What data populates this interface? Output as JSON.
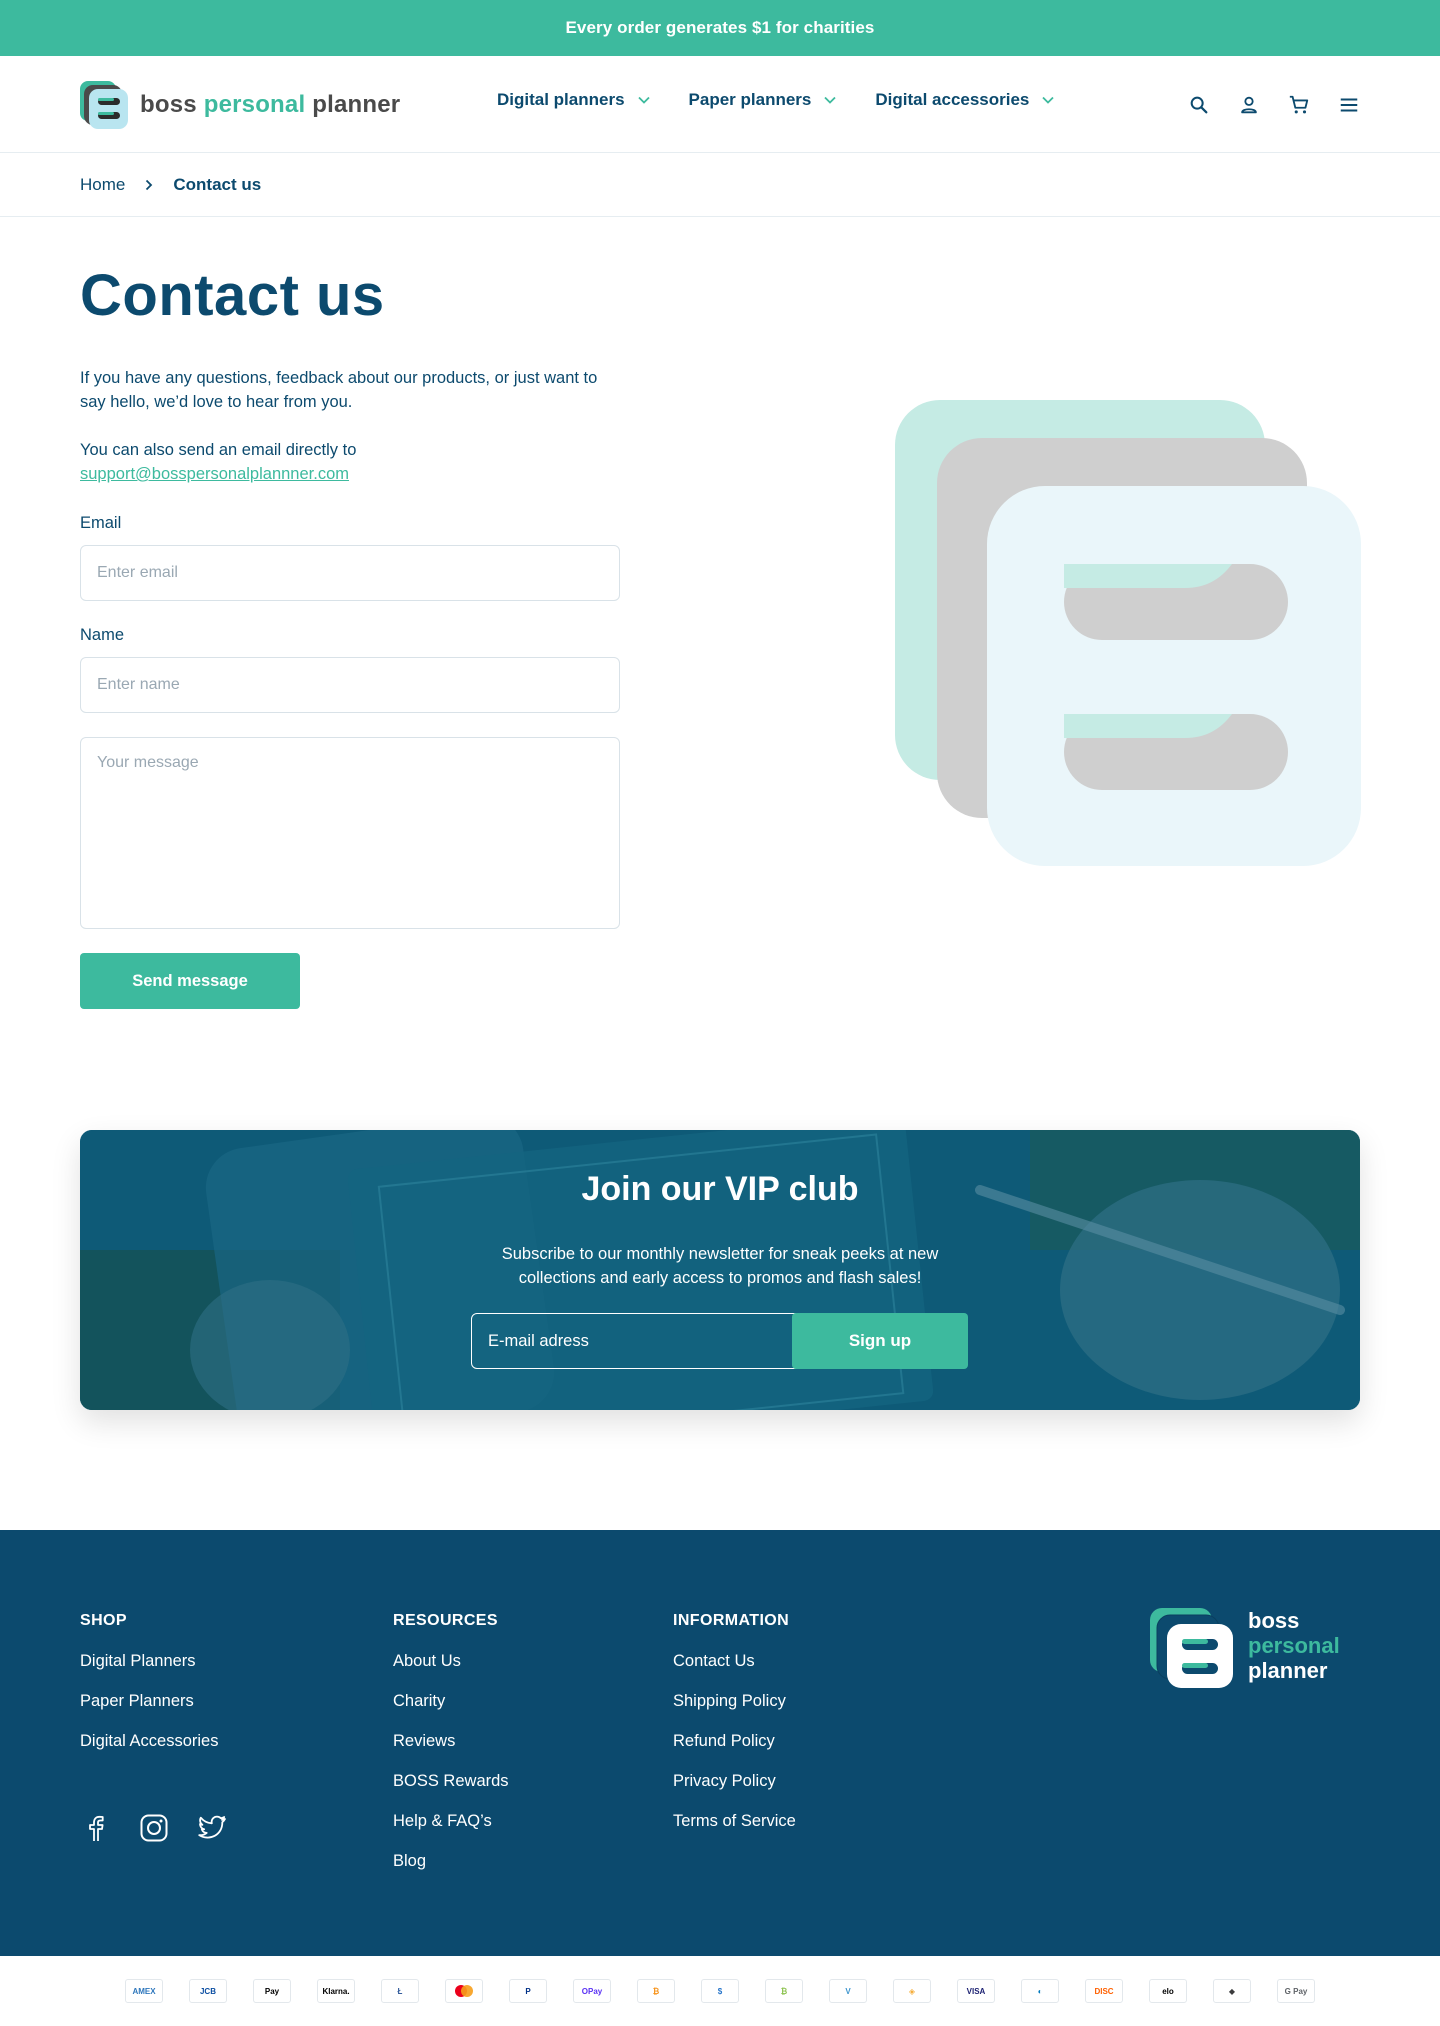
{
  "announcement": "Every order generates $1 for charities",
  "header": {
    "logo": {
      "word1": "boss",
      "word2": "personal",
      "word3": "planner"
    },
    "nav": [
      {
        "label": "Digital planners"
      },
      {
        "label": "Paper planners"
      },
      {
        "label": "Digital accessories"
      }
    ],
    "icons": [
      "search-icon",
      "account-icon",
      "cart-icon",
      "menu-icon"
    ]
  },
  "breadcrumb": {
    "home": "Home",
    "current": "Contact us"
  },
  "contact": {
    "title": "Contact us",
    "intro": "If you have any questions, feedback about our products,  or just want to say hello, we’d love to hear from you.",
    "email_intro": "You can also send an email directly to",
    "email_link": "support@bosspersonalplannner.com",
    "email_label": "Email",
    "email_placeholder": "Enter email",
    "name_label": "Name",
    "name_placeholder": "Enter name",
    "message_placeholder": "Your message",
    "send_label": "Send message"
  },
  "vip": {
    "title": "Join our VIP club",
    "subtitle_line1": "Subscribe to our monthly newsletter for sneak peeks at new",
    "subtitle_line2": "collections and early access to promos and flash sales!",
    "input_placeholder": "E-mail adress",
    "button_label": "Sign up"
  },
  "footer": {
    "shop": {
      "heading": "SHOP",
      "links": [
        "Digital Planners",
        "Paper Planners",
        "Digital Accessories"
      ]
    },
    "resources": {
      "heading": "RESOURCES",
      "links": [
        "About Us",
        "Charity",
        "Reviews",
        "BOSS Rewards",
        "Help & FAQ’s",
        "Blog"
      ]
    },
    "information": {
      "heading": "INFORMATION",
      "links": [
        "Contact Us",
        "Shipping Policy",
        "Refund Policy",
        "Privacy Policy",
        "Terms of Service"
      ]
    },
    "social": [
      "facebook-icon",
      "instagram-icon",
      "twitter-icon"
    ],
    "logo": {
      "line1": "boss",
      "line2": "personal",
      "line3": "planner"
    }
  },
  "payments": [
    {
      "name": "amex-icon",
      "label": "AMEX",
      "color": "#2e77bc"
    },
    {
      "name": "jcb-icon",
      "label": "JCB",
      "color": "#0b4ea2"
    },
    {
      "name": "apple-pay-icon",
      "label": "Pay",
      "color": "#000000"
    },
    {
      "name": "klarna-icon",
      "label": "Klarna.",
      "color": "#000000"
    },
    {
      "name": "litecoin-icon",
      "label": "Ł",
      "color": "#345d9d"
    },
    {
      "name": "mastercard-icon",
      "label": "",
      "color": "#eb001b"
    },
    {
      "name": "paypal-icon",
      "label": "P",
      "color": "#003087"
    },
    {
      "name": "opay-icon",
      "label": "OPay",
      "color": "#5a31f4"
    },
    {
      "name": "bitcoin-icon",
      "label": "₿",
      "color": "#f7931a"
    },
    {
      "name": "usdc-icon",
      "label": "$",
      "color": "#2775ca"
    },
    {
      "name": "bitcoin-cash-icon",
      "label": "₿",
      "color": "#8dc351"
    },
    {
      "name": "venmo-icon",
      "label": "V",
      "color": "#3d95ce"
    },
    {
      "name": "dai-icon",
      "label": "◈",
      "color": "#f5ac37"
    },
    {
      "name": "visa-icon",
      "label": "VISA",
      "color": "#1a1f71"
    },
    {
      "name": "diners-icon",
      "label": "◐",
      "color": "#0079be"
    },
    {
      "name": "discover-icon",
      "label": "DISC",
      "color": "#ff6000"
    },
    {
      "name": "elo-icon",
      "label": "elo",
      "color": "#000000"
    },
    {
      "name": "ethereum-icon",
      "label": "◆",
      "color": "#3c3c3d"
    },
    {
      "name": "google-pay-icon",
      "label": "G Pay",
      "color": "#5f6368"
    }
  ],
  "colors": {
    "brand_teal": "#3dba9e",
    "brand_navy": "#0c4a6e"
  }
}
